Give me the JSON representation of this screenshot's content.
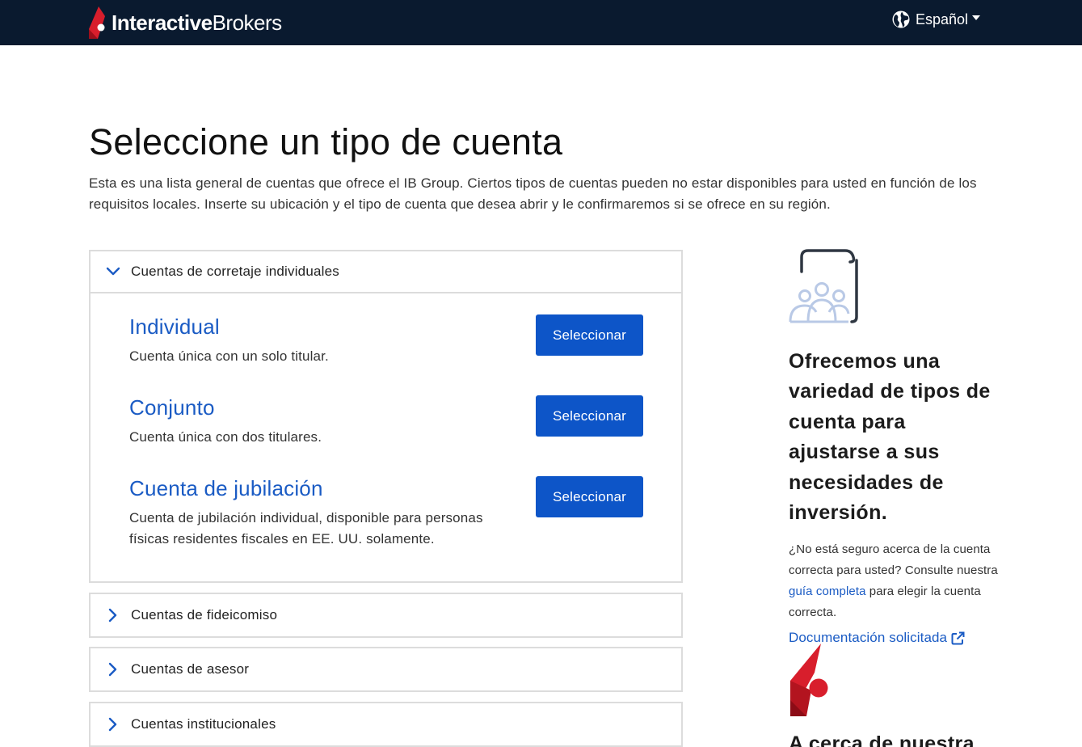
{
  "header": {
    "brand_bold": "Interactive",
    "brand_regular": "Brokers",
    "language_label": "Español"
  },
  "main": {
    "title": "Seleccione un tipo de cuenta",
    "intro": "Esta es una lista general de cuentas que ofrece el IB Group. Ciertos tipos de cuentas pueden no estar disponibles para usted en función de los requisitos locales. Inserte su ubicación y el tipo de cuenta que desea abrir y le confirmaremos si se ofrece en su región."
  },
  "accordion": [
    {
      "label": "Cuentas de corretaje individuales",
      "expanded": true,
      "accounts": [
        {
          "name": "Individual",
          "description": "Cuenta única con un solo titular.",
          "button": "Seleccionar"
        },
        {
          "name": "Conjunto",
          "description": "Cuenta única con dos titulares.",
          "button": "Seleccionar"
        },
        {
          "name": "Cuenta de jubilación",
          "description": "Cuenta de jubilación individual, disponible para personas físicas residentes fiscales en EE. UU. solamente.",
          "button": "Seleccionar"
        }
      ]
    },
    {
      "label": "Cuentas de fideicomiso",
      "expanded": false
    },
    {
      "label": "Cuentas de asesor",
      "expanded": false
    },
    {
      "label": "Cuentas institucionales",
      "expanded": false
    }
  ],
  "sidebar": {
    "icon": "group-document-icon",
    "heading": "Ofrecemos una variedad de tipos de cuenta para ajustarse a sus necesidades de inversión.",
    "text_before": "¿No está seguro acerca de la cuenta correcta para usted? Consulte nuestra ",
    "guide_link": "guía completa",
    "text_after": " para elegir la cuenta correcta.",
    "doc_link": "Documentación solicitada",
    "cut_heading": "A cerca de nuestra"
  },
  "colors": {
    "topbar": "#0a1a2f",
    "accent": "#1a5bc4",
    "button": "#0d55c8",
    "brand_red": "#d81e2c"
  }
}
